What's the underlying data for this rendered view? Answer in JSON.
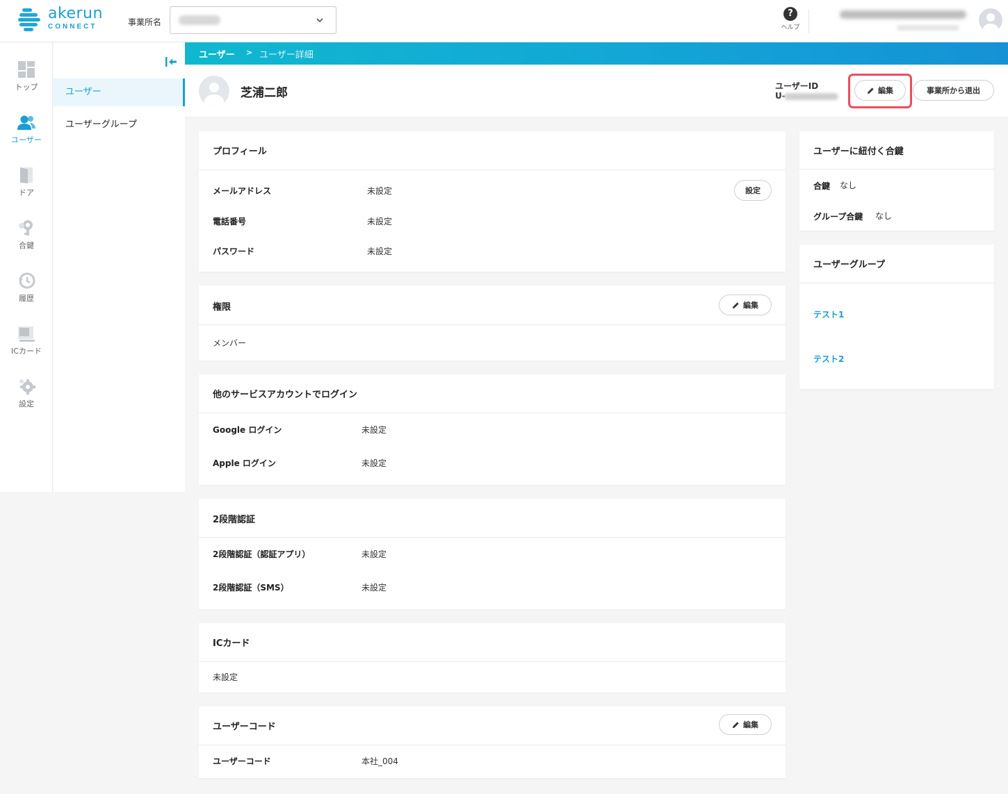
{
  "header": {
    "logo_word": "akerun",
    "logo_sub": "CONNECT",
    "office_label": "事業所名",
    "help_label": "ヘルプ",
    "help_symbol": "?"
  },
  "icon_nav": [
    {
      "key": "top",
      "label": "トップ",
      "icon": "dashboard-icon"
    },
    {
      "key": "users",
      "label": "ユーザー",
      "icon": "users-icon",
      "active": true
    },
    {
      "key": "door",
      "label": "ドア",
      "icon": "door-icon"
    },
    {
      "key": "key",
      "label": "合鍵",
      "icon": "key-icon"
    },
    {
      "key": "history",
      "label": "履歴",
      "icon": "history-icon"
    },
    {
      "key": "iccard",
      "label": "ICカード",
      "icon": "card-icon"
    },
    {
      "key": "settings",
      "label": "設定",
      "icon": "gear-icon"
    }
  ],
  "sub_nav": {
    "items": [
      {
        "label": "ユーザー",
        "active": true
      },
      {
        "label": "ユーザーグループ"
      }
    ]
  },
  "breadcrumb": {
    "parent": "ユーザー",
    "separator": ">",
    "current": "ユーザー詳細"
  },
  "user": {
    "name": "芝浦二郎",
    "id_label": "ユーザーID",
    "id_prefix": "U-"
  },
  "actions": {
    "edit": "編集",
    "leave": "事業所から退出"
  },
  "profile": {
    "title": "プロフィール",
    "set_button": "設定",
    "rows": [
      {
        "label": "メールアドレス",
        "value": "未設定"
      },
      {
        "label": "電話番号",
        "value": "未設定"
      },
      {
        "label": "パスワード",
        "value": "未設定"
      }
    ]
  },
  "permission": {
    "title": "権限",
    "edit_button": "編集",
    "value": "メンバー"
  },
  "social_login": {
    "title": "他のサービスアカウントでログイン",
    "rows": [
      {
        "label": "Google ログイン",
        "value": "未設定"
      },
      {
        "label": "Apple ログイン",
        "value": "未設定"
      }
    ]
  },
  "two_factor": {
    "title": "2段階認証",
    "rows": [
      {
        "label": "2段階認証（認証アプリ）",
        "value": "未設定"
      },
      {
        "label": "2段階認証（SMS）",
        "value": "未設定"
      }
    ]
  },
  "ic_card": {
    "title": "ICカード",
    "value": "未設定"
  },
  "user_code": {
    "title": "ユーザーコード",
    "edit_button": "編集",
    "rows": [
      {
        "label": "ユーザーコード",
        "value": "本社_004"
      }
    ]
  },
  "keys": {
    "title": "ユーザーに紐付く合鍵",
    "rows": [
      {
        "label": "合鍵",
        "value": "なし"
      },
      {
        "label": "グループ合鍵",
        "value": "なし"
      }
    ]
  },
  "groups": {
    "title": "ユーザーグループ",
    "items": [
      "テスト1",
      "テスト2"
    ]
  },
  "colors": {
    "accent": "#1a9fd0",
    "highlight": "#ec4d5a",
    "background": "#f5f5f5"
  }
}
